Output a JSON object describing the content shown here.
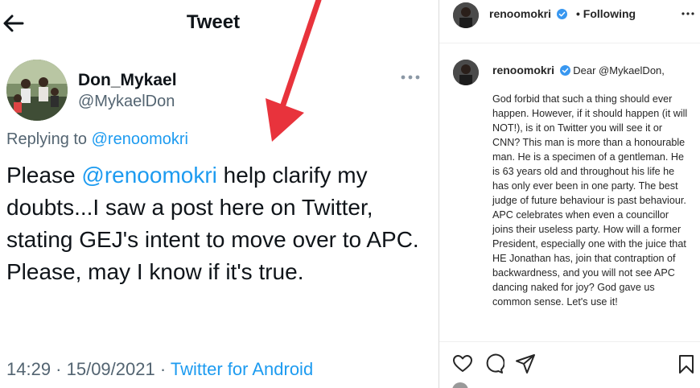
{
  "tweet": {
    "header_title": "Tweet",
    "display_name": "Don_Mykael",
    "handle": "@MykaelDon",
    "replying_prefix": "Replying to ",
    "replying_to": "@renoomokri",
    "text_before": "Please ",
    "text_mention": "@renoomokri",
    "text_after": " help clarify my doubts...I saw a post here on Twitter, stating GEJ's intent to move over to APC. Please, may I know if it's true.",
    "time": "14:29 · 15/09/2021 · ",
    "source": "Twitter for Android"
  },
  "instagram": {
    "username": "renoomokri",
    "following_label": "• Following",
    "caption_greeting": "Dear @MykaelDon,",
    "caption_body": "God forbid that such a thing should ever happen. However, if it should happen (it will NOT!), is it on Twitter you will see it or CNN? This man is more than a honourable man. He is a specimen of a gentleman. He is 63 years old and throughout his life he has only ever been in one party. The best judge of future behaviour is past behaviour. APC celebrates when even a councillor joins their useless party. How will a former President, especially one with the juice that HE Jonathan has, join that contraption of backwardness, and you will not see APC dancing naked for joy? God gave us common sense. Let's use it!",
    "verified_color": "#3897f0"
  },
  "colors": {
    "twitter_blue": "#1d9bf0",
    "arrow_red": "#e8333c"
  }
}
